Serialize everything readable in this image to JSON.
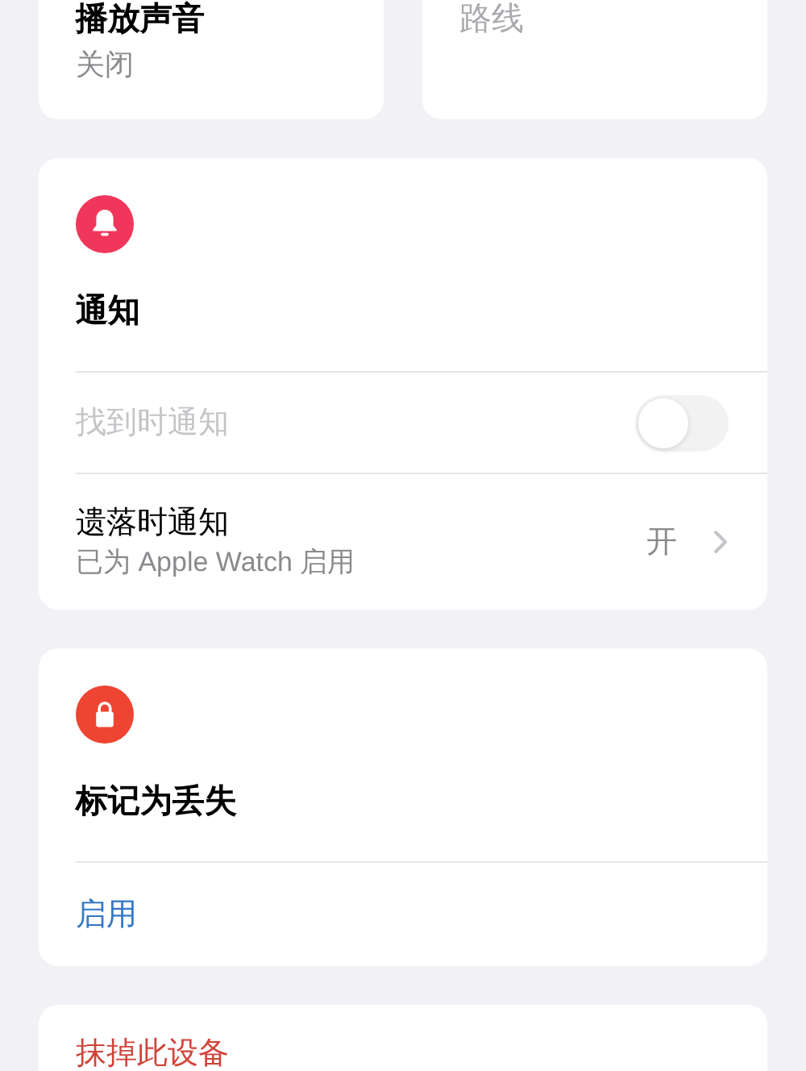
{
  "top_tiles": [
    {
      "title": "播放声音",
      "subtitle": "关闭",
      "disabled": false
    },
    {
      "title": "路线",
      "disabled": true
    }
  ],
  "sections": [
    {
      "kind": "bell",
      "color": "#f0365a",
      "title": "通知",
      "rows": [
        {
          "kind": "toggle",
          "label": "找到时通知",
          "disabled": true,
          "on": false
        },
        {
          "kind": "link",
          "label": "遗落时通知",
          "detail": "已为 Apple Watch 启用",
          "value": "开"
        }
      ]
    },
    {
      "kind": "lock",
      "color": "#ee4432",
      "title": "标记为丢失",
      "rows": [
        {
          "kind": "action",
          "label": "启用"
        }
      ]
    }
  ],
  "danger_action": {
    "label": "抹掉此设备"
  }
}
